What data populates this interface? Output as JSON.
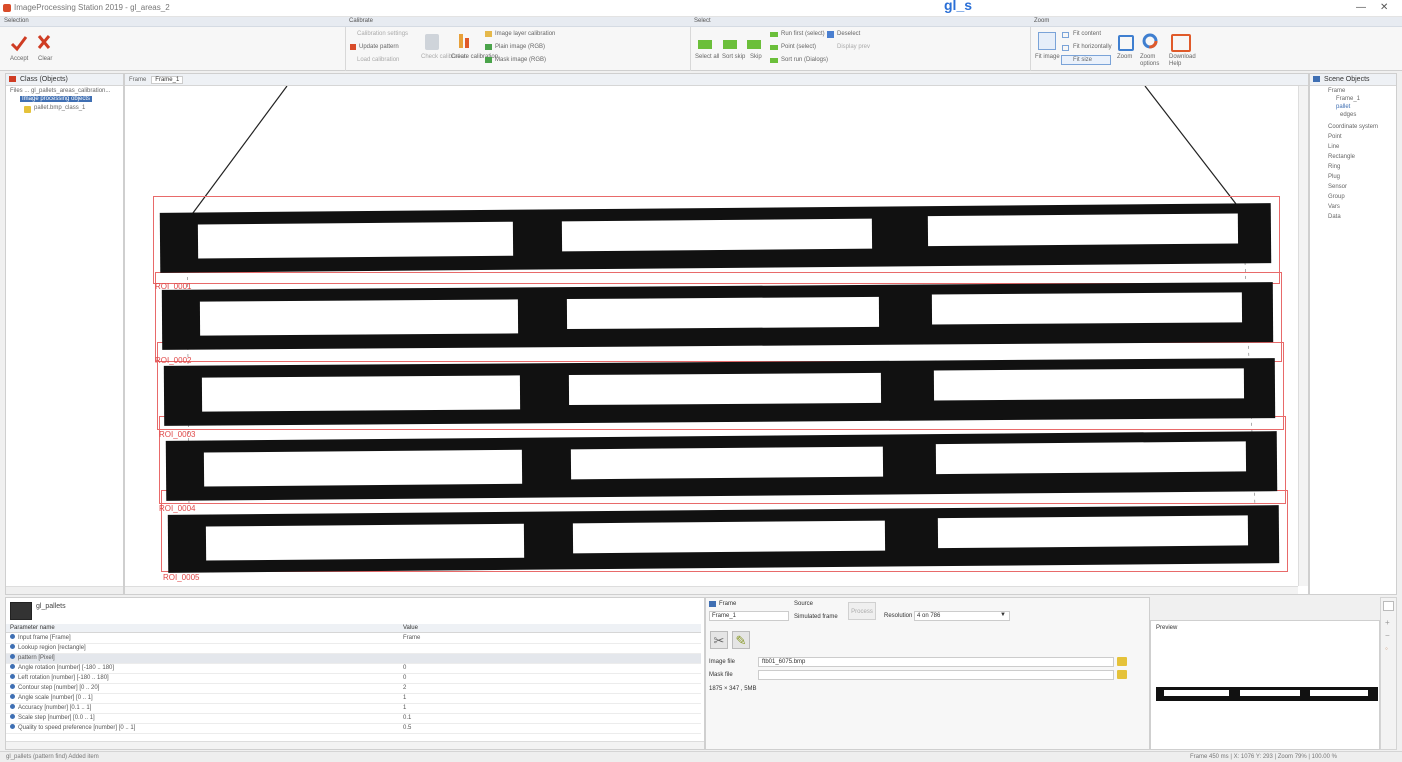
{
  "app": {
    "title": "ImageProcessing Station 2019 - gl_areas_2",
    "link_text": "gl_s"
  },
  "ribbon": {
    "groups": [
      {
        "label": "Selection"
      },
      {
        "label": "Calibrate"
      },
      {
        "label": "Select"
      },
      {
        "label": "Zoom"
      }
    ],
    "accept_label": "Accept",
    "clear_label": "Clear",
    "calibrate_items": [
      "Calibration settings",
      "Update pattern",
      "Load calibration"
    ],
    "calibrate_tall_1": "Check calibration",
    "calibrate_tall_2": "Create calibration",
    "image_items": [
      "Image layer calibration",
      "Plain image (RGB)",
      "Mask image (RGB)"
    ],
    "select_buttons": [
      "Select all",
      "Sort skip",
      "Skip"
    ],
    "select_items": [
      "Run first (select)",
      "Point (select)",
      "Sort run (Dialogs)"
    ],
    "select_items_2": [
      "Deselect",
      "Display prev"
    ],
    "zoom_items": [
      "Fit content",
      "Fit horizontally",
      "Fit size"
    ],
    "zoom_buttons": [
      "Fit image",
      "Zoom",
      "Zoom options",
      "Download Help"
    ]
  },
  "left_panel": {
    "title": "Class (Objects)",
    "items": [
      "Files ... gl_pallets_areas_calibration...",
      "Image processing objects",
      "pallet.bmp_class_1"
    ]
  },
  "image_panel": {
    "tab_label": "Frame_1",
    "tab_prefix": "Frame",
    "region_labels": [
      "ROI_0001",
      "ROI_0002",
      "ROI_0003",
      "ROI_0004",
      "ROI_0005"
    ]
  },
  "right_panel": {
    "title": "Scene Objects",
    "items": [
      "Frame",
      "Frame_1",
      "pallet",
      "edges",
      "Coordinate system",
      "Point",
      "Line",
      "Rectangle",
      "Ring",
      "Plug",
      "Sensor",
      "Group",
      "Vars",
      "Data"
    ]
  },
  "properties": {
    "title": "gl_pallets",
    "col_name": "Parameter name",
    "col_value": "Value",
    "rows": [
      {
        "name": "Input frame [Frame]",
        "value": "Frame"
      },
      {
        "name": "Lookup region [rectangle]",
        "value": ""
      },
      {
        "name": "pattern [Pixel]",
        "value": ""
      },
      {
        "name": "Angle rotation [number] [-180 .. 180]",
        "value": "0"
      },
      {
        "name": "Left rotation [number] [-180 .. 180]",
        "value": "0"
      },
      {
        "name": "Contour step [number] [0 .. 20]",
        "value": "2"
      },
      {
        "name": "Angle scale [number] [0 .. 1]",
        "value": "1"
      },
      {
        "name": "Accuracy [number] [0.1 .. 1]",
        "value": "1"
      },
      {
        "name": "Scale step [number] [0.0 .. 1]",
        "value": "0.1"
      },
      {
        "name": "Quality to speed preference [number] [0 .. 1]",
        "value": "0.5"
      }
    ]
  },
  "frame_panel": {
    "section_label": "Frame",
    "frame_value": "Frame_1",
    "source_label": "Source",
    "source_value": "Simulated frame",
    "process_label": "Process",
    "resolution_label": "Resolution",
    "resolution_value": "4 on 786",
    "image_file_label": "Image file",
    "image_file_value": "ftb01_6075.bmp",
    "mask_file_label": "Mask file",
    "mask_file_value": "",
    "size_text": "1875 × 347 , 5MB"
  },
  "preview": {
    "title": "Preview"
  },
  "status": {
    "left": "gl_pallets (pattern find) Added item",
    "right": "Frame 450 ms | X: 1076  Y: 293 | Zoom 79% | 100.00 %"
  },
  "colors": {
    "accent": "#3f6fb3",
    "region_border": "#e86a6a",
    "pallet": "#111111"
  }
}
